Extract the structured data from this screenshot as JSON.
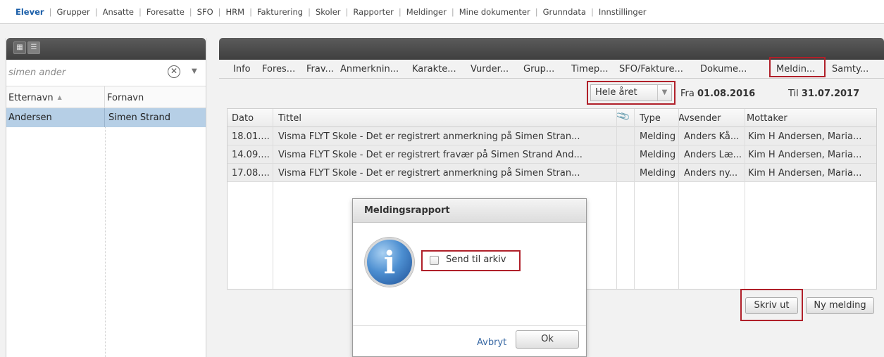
{
  "nav": {
    "items": [
      "Elever",
      "Grupper",
      "Ansatte",
      "Foresatte",
      "SFO",
      "HRM",
      "Fakturering",
      "Skoler",
      "Rapporter",
      "Meldinger",
      "Mine dokumenter",
      "Grunndata",
      "Innstillinger"
    ],
    "active": "Elever"
  },
  "left": {
    "search_value": "simen ander",
    "columns": [
      "Etternavn",
      "Fornavn"
    ],
    "rows": [
      {
        "etternavn": "Andersen",
        "fornavn": "Simen Strand"
      }
    ]
  },
  "tabs": [
    "Info",
    "Fores...",
    "Frav...",
    "Anmerknin...",
    "Karakte...",
    "Vurder...",
    "Grup...",
    "Timep...",
    "SFO/Fakture...",
    "Dokume...",
    "Meldin...",
    "Samty..."
  ],
  "filter": {
    "period": "Hele året",
    "fra_label": "Fra",
    "fra_date": "01.08.2016",
    "til_label": "Til",
    "til_date": "31.07.2017"
  },
  "table": {
    "headers": {
      "dato": "Dato",
      "tittel": "Tittel",
      "type": "Type",
      "avsender": "Avsender",
      "mottaker": "Mottaker"
    },
    "rows": [
      {
        "dato": "18.01....",
        "tittel": "Visma FLYT Skole - Det er registrert anmerkning på Simen Stran...",
        "type": "Melding",
        "avsender": "Anders Kå...",
        "mottaker": "Kim H Andersen, Maria..."
      },
      {
        "dato": "14.09....",
        "tittel": "Visma FLYT Skole - Det er registrert fravær på Simen Strand And...",
        "type": "Melding",
        "avsender": "Anders Læ...",
        "mottaker": "Kim H Andersen, Maria..."
      },
      {
        "dato": "17.08....",
        "tittel": "Visma FLYT Skole - Det er registrert anmerkning på Simen Stran...",
        "type": "Melding",
        "avsender": "Anders ny...",
        "mottaker": "Kim H Andersen, Maria..."
      }
    ]
  },
  "buttons": {
    "skriv_ut": "Skriv ut",
    "ny_melding": "Ny melding"
  },
  "dialog": {
    "title": "Meldingsrapport",
    "checkbox_label": "Send til arkiv",
    "cancel": "Avbryt",
    "ok": "Ok"
  },
  "colors": {
    "accent": "#1a5ea8",
    "highlight_box": "#b0202a",
    "selected_row": "#b6cfe6"
  }
}
